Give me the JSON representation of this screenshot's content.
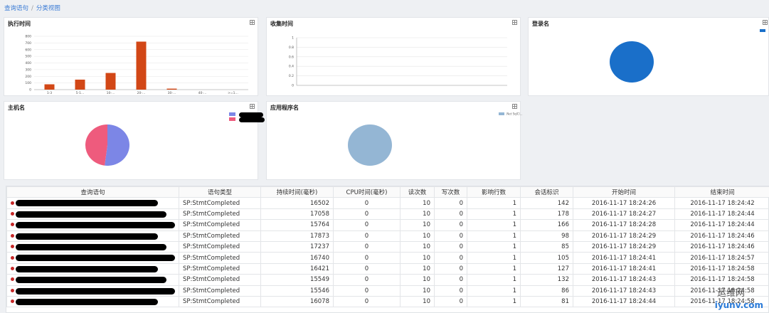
{
  "breadcrumb": {
    "home": "查询语句",
    "current": "分类视图"
  },
  "panels": {
    "exec_time": "执行时间",
    "collect_time": "收集时间",
    "login": "登录名",
    "host": "主机名",
    "app": "应用程序名"
  },
  "colors": {
    "bar": "#d24716",
    "login_pie": "#1a6fc9",
    "host_a": "#7c86e6",
    "host_b": "#ee5b7d",
    "app_pie": "#94b6d4",
    "link": "#3a7bd5"
  },
  "chart_data": [
    {
      "type": "bar",
      "title": "执行时间",
      "categories": [
        "1-3",
        "5-1...",
        "10-...",
        "20-...",
        "30-...",
        "40-...",
        ">=1..."
      ],
      "values": [
        80,
        150,
        250,
        720,
        15,
        0,
        0
      ],
      "yticks": [
        0,
        100,
        200,
        300,
        400,
        500,
        600,
        700,
        800
      ],
      "ylim": [
        0,
        800
      ],
      "grid": true
    },
    {
      "type": "line",
      "title": "收集时间",
      "yticks": [
        "0",
        "0.2",
        "0.4",
        "0.6",
        "0.8",
        "1"
      ],
      "ylim": [
        0,
        1
      ],
      "series": []
    },
    {
      "type": "pie",
      "title": "登录名",
      "slices": [
        {
          "value": 100
        }
      ]
    },
    {
      "type": "pie",
      "title": "主机名",
      "slices": [
        {
          "value": 52
        },
        {
          "value": 48
        }
      ]
    },
    {
      "type": "pie",
      "title": "应用程序名",
      "legend": ".Net SqlCl...",
      "slices": [
        {
          "name": ".Net SqlCl...",
          "value": 100
        }
      ]
    }
  ],
  "table": {
    "headers": [
      "查询语句",
      "语句类型",
      "持续时间(毫秒)",
      "CPU时间(毫秒)",
      "读次数",
      "写次数",
      "影响行数",
      "会话标识",
      "开始时间",
      "结束时间"
    ],
    "rows": [
      [
        "",
        "SP:StmtCompleted",
        "16502",
        "0",
        "10",
        "0",
        "1",
        "142",
        "2016-11-17 18:24:26",
        "2016-11-17 18:24:42"
      ],
      [
        "",
        "SP:StmtCompleted",
        "17058",
        "0",
        "10",
        "0",
        "1",
        "178",
        "2016-11-17 18:24:27",
        "2016-11-17 18:24:44"
      ],
      [
        "",
        "SP:StmtCompleted",
        "15764",
        "0",
        "10",
        "0",
        "1",
        "166",
        "2016-11-17 18:24:28",
        "2016-11-17 18:24:44"
      ],
      [
        "",
        "SP:StmtCompleted",
        "17873",
        "0",
        "10",
        "0",
        "1",
        "98",
        "2016-11-17 18:24:29",
        "2016-11-17 18:24:46"
      ],
      [
        "",
        "SP:StmtCompleted",
        "17237",
        "0",
        "10",
        "0",
        "1",
        "85",
        "2016-11-17 18:24:29",
        "2016-11-17 18:24:46"
      ],
      [
        "",
        "SP:StmtCompleted",
        "16740",
        "0",
        "10",
        "0",
        "1",
        "105",
        "2016-11-17 18:24:41",
        "2016-11-17 18:24:57"
      ],
      [
        "",
        "SP:StmtCompleted",
        "16421",
        "0",
        "10",
        "0",
        "1",
        "127",
        "2016-11-17 18:24:41",
        "2016-11-17 18:24:58"
      ],
      [
        "",
        "SP:StmtCompleted",
        "15549",
        "0",
        "10",
        "0",
        "1",
        "132",
        "2016-11-17 18:24:43",
        "2016-11-17 18:24:58"
      ],
      [
        "",
        "SP:StmtCompleted",
        "15546",
        "0",
        "10",
        "0",
        "1",
        "86",
        "2016-11-17 18:24:43",
        "2016-11-17 18:24:58"
      ],
      [
        "",
        "SP:StmtCompleted",
        "16078",
        "0",
        "10",
        "0",
        "1",
        "81",
        "2016-11-17 18:24:44",
        "2016-11-17 18:24:58"
      ]
    ]
  },
  "watermark": {
    "big": "运维网",
    "small": "iyunv.com"
  }
}
